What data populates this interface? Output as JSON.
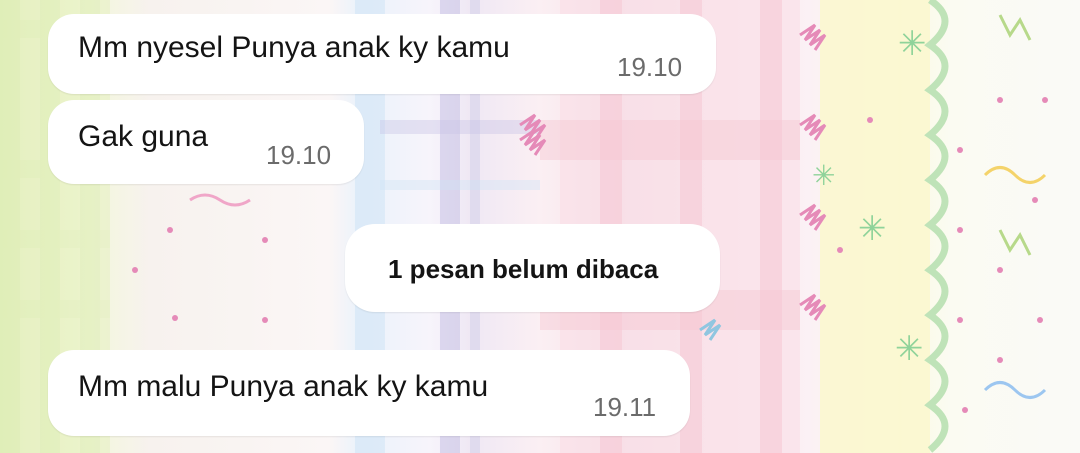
{
  "messages": [
    {
      "text": "Mm nyesel Punya anak ky kamu",
      "time": "19.10"
    },
    {
      "text": "Gak guna",
      "time": "19.10"
    },
    {
      "text": "Mm malu Punya anak ky kamu",
      "time": "19.11"
    }
  ],
  "unread_indicator": {
    "label": "1 pesan belum dibaca"
  },
  "colors": {
    "bubble": "#ffffff",
    "text": "#141414",
    "time": "#6b6b6b"
  }
}
